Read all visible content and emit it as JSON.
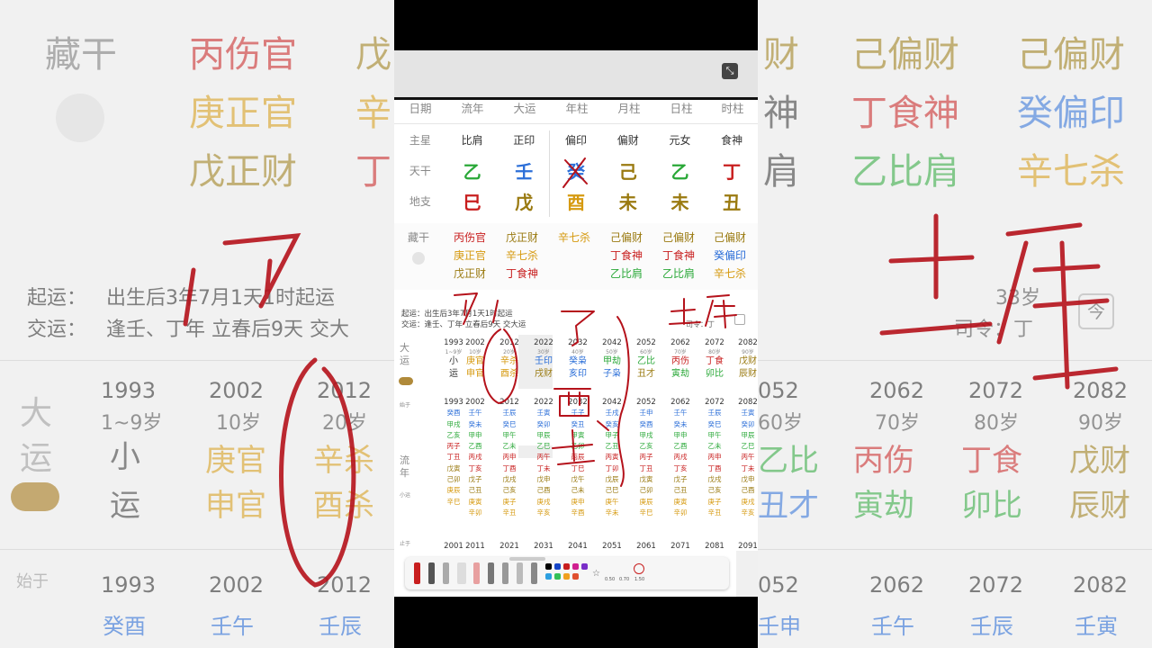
{
  "left_bg": {
    "hide_label": "藏干",
    "hide_cols": [
      [
        "丙伤官",
        "庚正官",
        "戊正财"
      ],
      [
        "戊",
        "辛",
        "丁"
      ]
    ],
    "qiyun_label": "起运：",
    "qiyun_text": "出生后3年7月1天1时起运",
    "jiaoyun_label": "交运：",
    "jiaoyun_text": "逢壬、丁年 立春后9天 交大",
    "dayun_label_1": "大",
    "dayun_label_2": "运",
    "years": [
      "1993",
      "2002",
      "2012"
    ],
    "ages": [
      "1~9岁",
      "10岁",
      "20岁"
    ],
    "xiao": "小",
    "yun": "运",
    "col2": [
      "庚官",
      "申官"
    ],
    "col3": [
      "辛杀",
      "酉杀"
    ],
    "start_label": "始于",
    "bottom": [
      "癸酉",
      "壬午",
      "壬辰"
    ]
  },
  "right_bg": {
    "rows": [
      [
        "财",
        "己偏财",
        "己偏财"
      ],
      [
        "神",
        "丁食神",
        "癸偏印"
      ],
      [
        "肩",
        "乙比肩",
        "辛七杀"
      ]
    ],
    "age_top": "33岁",
    "siling": "司令：丁",
    "today": "今",
    "years": [
      "052",
      "2062",
      "2072",
      "2082"
    ],
    "ages": [
      "60岁",
      "70岁",
      "80岁",
      "90岁"
    ],
    "row1": [
      "乙比",
      "丙伤",
      "丁食",
      "戊财"
    ],
    "row2": [
      "丑才",
      "寅劫",
      "卯比",
      "辰财"
    ],
    "bottom_years": [
      "052",
      "2062",
      "2072",
      "2082"
    ],
    "bottom": [
      "壬申",
      "壬午",
      "壬辰",
      "壬寅"
    ]
  },
  "phone": {
    "header": [
      "日期",
      "流年",
      "大运",
      "年柱",
      "月柱",
      "日柱",
      "时柱"
    ],
    "zhuxing_label": "主星",
    "zhuxing": [
      "比肩",
      "正印",
      "偏印",
      "偏财",
      "元女",
      "食神"
    ],
    "tiangan_label": "天干",
    "tiangan": [
      "乙",
      "壬",
      "癸",
      "己",
      "乙",
      "丁"
    ],
    "dizhi_label": "地支",
    "dizhi": [
      "巳",
      "戊",
      "酉",
      "未",
      "未",
      "丑"
    ],
    "canggan_label": "藏干",
    "canggan": [
      [
        "丙伤官",
        "庚正官",
        "戊正财"
      ],
      [
        "戊正财",
        "辛七杀",
        "丁食神"
      ],
      [
        "辛七杀"
      ],
      [
        "己偏财",
        "丁食神",
        "乙比肩"
      ],
      [
        "己偏财",
        "丁食神",
        "乙比肩"
      ],
      [
        "己偏财",
        "癸偏印",
        "辛七杀"
      ]
    ],
    "qiyun": "起运：出生后3年7月1天1时起运",
    "jiaoyun": "交运：逢壬、丁年 立春后9天 交大运",
    "siling": "司令：丁",
    "dayun_label": [
      "大",
      "运"
    ],
    "dayun": [
      {
        "year": "1993",
        "age": "1~9岁",
        "g": "小",
        "z": "运"
      },
      {
        "year": "2002",
        "age": "10岁",
        "g": "庚官",
        "z": "申官"
      },
      {
        "year": "2012",
        "age": "20岁",
        "g": "辛杀",
        "z": "酉杀"
      },
      {
        "year": "2022",
        "age": "30岁",
        "g": "壬印",
        "z": "戌财"
      },
      {
        "year": "2032",
        "age": "40岁",
        "g": "癸枭",
        "z": "亥印"
      },
      {
        "year": "2042",
        "age": "50岁",
        "g": "甲劫",
        "z": "子枭"
      },
      {
        "year": "2052",
        "age": "60岁",
        "g": "乙比",
        "z": "丑才"
      },
      {
        "year": "2062",
        "age": "70岁",
        "g": "丙伤",
        "z": "寅劫"
      },
      {
        "year": "2072",
        "age": "80岁",
        "g": "丁食",
        "z": "卯比"
      },
      {
        "year": "2082",
        "age": "90岁",
        "g": "戊财",
        "z": "辰财"
      }
    ],
    "liunian_start_label": "始于",
    "liunian_label": [
      "流",
      "年"
    ],
    "xiaoyun_label": "小运",
    "liunian_end_label": "止于",
    "liunian": [
      {
        "start": "1993",
        "items": [
          "癸酉",
          "甲戌",
          "乙亥",
          "丙子",
          "丁丑",
          "戊寅",
          "己卯",
          "庚辰",
          "辛巳"
        ],
        "end": "2001"
      },
      {
        "start": "2002",
        "items": [
          "壬午",
          "癸未",
          "甲申",
          "乙酉",
          "丙戌",
          "丁亥",
          "戊子",
          "己丑",
          "庚寅",
          "辛卯"
        ],
        "end": "2011"
      },
      {
        "start": "2012",
        "items": [
          "壬辰",
          "癸巳",
          "甲午",
          "乙未",
          "丙申",
          "丁酉",
          "戊戌",
          "己亥",
          "庚子",
          "辛丑"
        ],
        "end": "2021"
      },
      {
        "start": "2022",
        "items": [
          "壬寅",
          "癸卯",
          "甲辰",
          "乙巳",
          "丙午",
          "丁未",
          "戊申",
          "己酉",
          "庚戌",
          "辛亥"
        ],
        "end": "2031"
      },
      {
        "start": "2032",
        "items": [
          "壬子",
          "癸丑",
          "甲寅",
          "乙卯",
          "丙辰",
          "丁巳",
          "戊午",
          "己未",
          "庚申",
          "辛酉"
        ],
        "end": "2041"
      },
      {
        "start": "2042",
        "items": [
          "壬戌",
          "癸亥",
          "甲子",
          "乙丑",
          "丙寅",
          "丁卯",
          "戊辰",
          "己巳",
          "庚午",
          "辛未"
        ],
        "end": "2051"
      },
      {
        "start": "2052",
        "items": [
          "壬申",
          "癸酉",
          "甲戌",
          "乙亥",
          "丙子",
          "丁丑",
          "戊寅",
          "己卯",
          "庚辰",
          "辛巳"
        ],
        "end": "2061"
      },
      {
        "start": "2062",
        "items": [
          "壬午",
          "癸未",
          "甲申",
          "乙酉",
          "丙戌",
          "丁亥",
          "戊子",
          "己丑",
          "庚寅",
          "辛卯"
        ],
        "end": "2071"
      },
      {
        "start": "2072",
        "items": [
          "壬辰",
          "癸巳",
          "甲午",
          "乙未",
          "丙申",
          "丁酉",
          "戊戌",
          "己亥",
          "庚子",
          "辛丑"
        ],
        "end": "2081"
      },
      {
        "start": "2082",
        "items": [
          "壬寅",
          "癸卯",
          "甲辰",
          "乙巳",
          "丙午",
          "丁未",
          "戊申",
          "己酉",
          "庚戌",
          "辛亥"
        ],
        "end": "2091"
      }
    ],
    "toolbar_sizes": [
      "0.50",
      "0.70",
      "1.50"
    ]
  },
  "colors": {
    "wood": "#2aa838",
    "water": "#2c6fd8",
    "fire": "#c81e1e",
    "earth": "#9a7a10",
    "metal": "#d69a10",
    "ink": "#b5121b"
  }
}
